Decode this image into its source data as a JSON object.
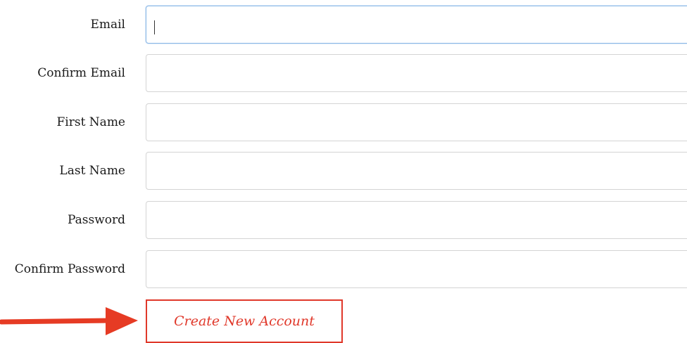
{
  "form": {
    "fields": [
      {
        "label": "Email",
        "value": "",
        "placeholder": ""
      },
      {
        "label": "Confirm Email",
        "value": "",
        "placeholder": ""
      },
      {
        "label": "First Name",
        "value": "",
        "placeholder": ""
      },
      {
        "label": "Last Name",
        "value": "",
        "placeholder": ""
      },
      {
        "label": "Password",
        "value": "",
        "placeholder": ""
      },
      {
        "label": "Confirm Password",
        "value": "",
        "placeholder": ""
      }
    ],
    "submit_label": "Create New Account"
  },
  "colors": {
    "accent": "#e0382a",
    "field_border": "#d4d4d4",
    "focus_border": "#8ab8e6"
  },
  "icons": {
    "pointer": "arrow-right-icon"
  }
}
